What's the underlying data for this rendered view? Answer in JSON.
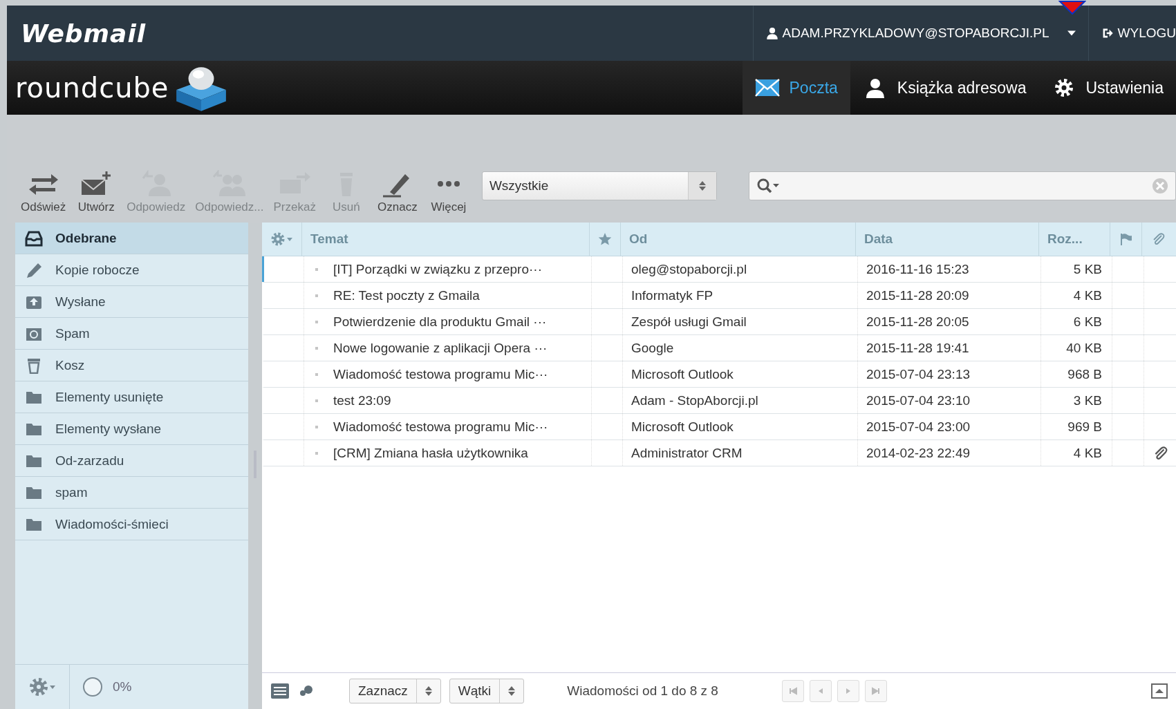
{
  "header": {
    "brand": "Webmail",
    "user": "ADAM.PRZYKLADOWY@STOPABORCJI.PL",
    "logout": "WYLOGU",
    "logo": "roundcube"
  },
  "nav": [
    {
      "label": "Poczta",
      "kind": "mail",
      "selected": true
    },
    {
      "label": "Książka adresowa",
      "kind": "contacts",
      "selected": false
    },
    {
      "label": "Ustawienia",
      "kind": "settings",
      "selected": false
    }
  ],
  "toolbar": [
    {
      "label": "Odśwież",
      "kind": "refresh",
      "disabled": false
    },
    {
      "label": "Utwórz",
      "kind": "compose",
      "disabled": false
    },
    {
      "label": "Odpowiedz",
      "kind": "reply",
      "disabled": true
    },
    {
      "label": "Odpowiedz...",
      "kind": "replyall",
      "disabled": true
    },
    {
      "label": "Przekaż",
      "kind": "forward",
      "disabled": true
    },
    {
      "label": "Usuń",
      "kind": "delete",
      "disabled": true
    },
    {
      "label": "Oznacz",
      "kind": "mark",
      "disabled": false
    },
    {
      "label": "Więcej",
      "kind": "more",
      "disabled": false
    }
  ],
  "filter": {
    "value": "Wszystkie"
  },
  "folders": [
    {
      "name": "Odebrane",
      "kind": "inbox",
      "selected": true
    },
    {
      "name": "Kopie robocze",
      "kind": "drafts",
      "selected": false
    },
    {
      "name": "Wysłane",
      "kind": "sent",
      "selected": false
    },
    {
      "name": "Spam",
      "kind": "spam",
      "selected": false
    },
    {
      "name": "Kosz",
      "kind": "trash",
      "selected": false
    },
    {
      "name": "Elementy usunięte",
      "kind": "folder",
      "selected": false
    },
    {
      "name": "Elementy wysłane",
      "kind": "folder",
      "selected": false
    },
    {
      "name": "Od-zarzadu",
      "kind": "folder",
      "selected": false
    },
    {
      "name": "spam",
      "kind": "folder",
      "selected": false
    },
    {
      "name": "Wiadomości-śmieci",
      "kind": "folder",
      "selected": false
    }
  ],
  "quota": "0%",
  "table": {
    "columns": [
      "Temat",
      "Od",
      "Data",
      "Roz..."
    ],
    "rows": [
      {
        "subject": "[IT] Porządki w związku z przepro···",
        "from": "oleg@stopaborcji.pl",
        "date": "2016-11-16 15:23",
        "size": "5 KB",
        "attachment": false,
        "focused": true
      },
      {
        "subject": "RE: Test poczty z Gmaila",
        "from": "Informatyk FP",
        "date": "2015-11-28 20:09",
        "size": "4 KB",
        "attachment": false,
        "focused": false
      },
      {
        "subject": "Potwierdzenie dla produktu Gmail ···",
        "from": "Zespół usługi Gmail",
        "date": "2015-11-28 20:05",
        "size": "6 KB",
        "attachment": false,
        "focused": false
      },
      {
        "subject": "Nowe logowanie z aplikacji Opera ···",
        "from": "Google",
        "date": "2015-11-28 19:41",
        "size": "40 KB",
        "attachment": false,
        "focused": false
      },
      {
        "subject": "Wiadomość testowa programu Mic···",
        "from": "Microsoft Outlook",
        "date": "2015-07-04 23:13",
        "size": "968 B",
        "attachment": false,
        "focused": false
      },
      {
        "subject": "test 23:09",
        "from": "Adam - StopAborcji.pl",
        "date": "2015-07-04 23:10",
        "size": "3 KB",
        "attachment": false,
        "focused": false
      },
      {
        "subject": "Wiadomość testowa programu Mic···",
        "from": "Microsoft Outlook",
        "date": "2015-07-04 23:00",
        "size": "969 B",
        "attachment": false,
        "focused": false
      },
      {
        "subject": "[CRM] Zmiana hasła użytkownika",
        "from": "Administrator CRM",
        "date": "2014-02-23 22:49",
        "size": "4 KB",
        "attachment": true,
        "focused": false
      }
    ]
  },
  "footer": {
    "select": "Zaznacz",
    "threads": "Wątki",
    "count": "Wiadomości od 1 do 8 z 8"
  }
}
